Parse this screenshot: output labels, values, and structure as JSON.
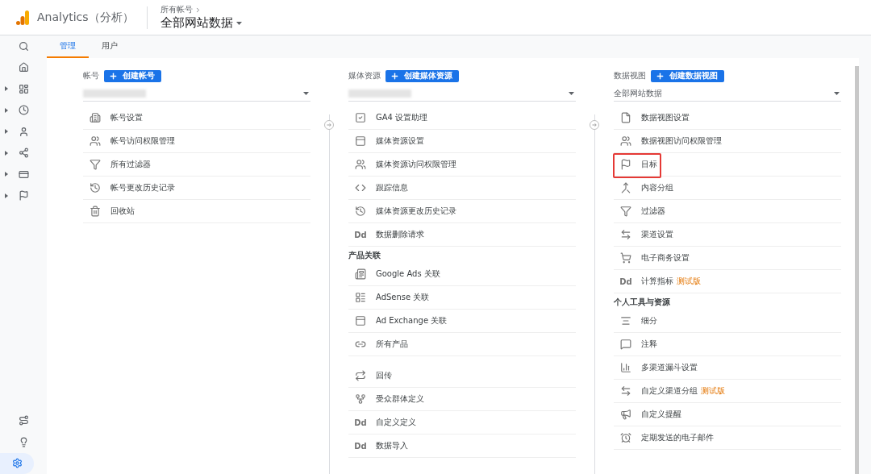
{
  "header": {
    "product": "Analytics（分析）",
    "breadcrumb": "所有帐号",
    "title": "全部网站数据"
  },
  "rail": {
    "top": [
      {
        "selected": false,
        "expandable": false
      },
      {
        "selected": false,
        "expandable": false
      },
      {
        "selected": false,
        "expandable": true
      },
      {
        "selected": false,
        "expandable": true
      },
      {
        "selected": false,
        "expandable": true
      },
      {
        "selected": false,
        "expandable": true
      },
      {
        "selected": false,
        "expandable": true
      },
      {
        "selected": false,
        "expandable": true
      }
    ],
    "bottom": [
      {
        "selected": false,
        "expandable": false
      },
      {
        "selected": false,
        "expandable": false
      },
      {
        "selected": true,
        "expandable": false
      }
    ]
  },
  "tabs": [
    {
      "label": "管理",
      "selected": true
    },
    {
      "label": "用户",
      "selected": false
    }
  ],
  "columns": [
    {
      "label": "帐号",
      "button": "创建帐号",
      "dropdown": {
        "blurred": true
      },
      "sections": [
        {
          "items": [
            {
              "label": "帐号设置",
              "highlighted": false
            },
            {
              "label": "帐号访问权限管理",
              "highlighted": false
            },
            {
              "label": "所有过滤器",
              "highlighted": false
            },
            {
              "label": "帐号更改历史记录",
              "highlighted": false
            },
            {
              "label": "回收站",
              "highlighted": false
            }
          ]
        }
      ]
    },
    {
      "label": "媒体资源",
      "button": "创建媒体资源",
      "dropdown": {
        "blurred": true
      },
      "sections": [
        {
          "items": [
            {
              "label": "GA4 设置助理",
              "highlighted": false
            },
            {
              "label": "媒体资源设置",
              "highlighted": false
            },
            {
              "label": "媒体资源访问权限管理",
              "highlighted": false
            },
            {
              "label": "跟踪信息",
              "highlighted": false
            },
            {
              "label": "媒体资源更改历史记录",
              "highlighted": false
            },
            {
              "label": "数据删除请求",
              "icon_text": "Dd",
              "highlighted": false
            }
          ]
        },
        {
          "title": "产品关联",
          "items": [
            {
              "label": "Google Ads 关联",
              "highlighted": false
            },
            {
              "label": "AdSense 关联",
              "highlighted": false
            },
            {
              "label": "Ad Exchange 关联",
              "highlighted": false
            },
            {
              "label": "所有产品",
              "highlighted": false
            }
          ]
        },
        {
          "items": [
            {
              "label": "回传",
              "highlighted": false
            },
            {
              "label": "受众群体定义",
              "highlighted": false
            },
            {
              "label": "自定义定义",
              "icon_text": "Dd",
              "highlighted": false
            },
            {
              "label": "数据导入",
              "icon_text": "Dd",
              "highlighted": false
            }
          ]
        }
      ]
    },
    {
      "label": "数据视图",
      "button": "创建数据视图",
      "dropdown": {
        "blurred": false,
        "value": "全部网站数据"
      },
      "sections": [
        {
          "items": [
            {
              "label": "数据视图设置",
              "highlighted": false
            },
            {
              "label": "数据视图访问权限管理",
              "highlighted": false
            },
            {
              "label": "目标",
              "highlighted": true
            },
            {
              "label": "内容分组",
              "highlighted": false
            },
            {
              "label": "过滤器",
              "highlighted": false
            },
            {
              "label": "渠道设置",
              "highlighted": false
            },
            {
              "label": "电子商务设置",
              "highlighted": false
            },
            {
              "label": "计算指标",
              "icon_text": "Dd",
              "badge": "测试版",
              "highlighted": false
            }
          ]
        },
        {
          "title": "个人工具与资源",
          "items": [
            {
              "label": "细分",
              "highlighted": false
            },
            {
              "label": "注释",
              "highlighted": false
            },
            {
              "label": "多渠道漏斗设置",
              "highlighted": false
            },
            {
              "label": "自定义渠道分组",
              "badge": "测试版",
              "highlighted": false
            },
            {
              "label": "自定义提醒",
              "highlighted": false
            },
            {
              "label": "定期发送的电子邮件",
              "highlighted": false
            }
          ]
        }
      ]
    }
  ]
}
